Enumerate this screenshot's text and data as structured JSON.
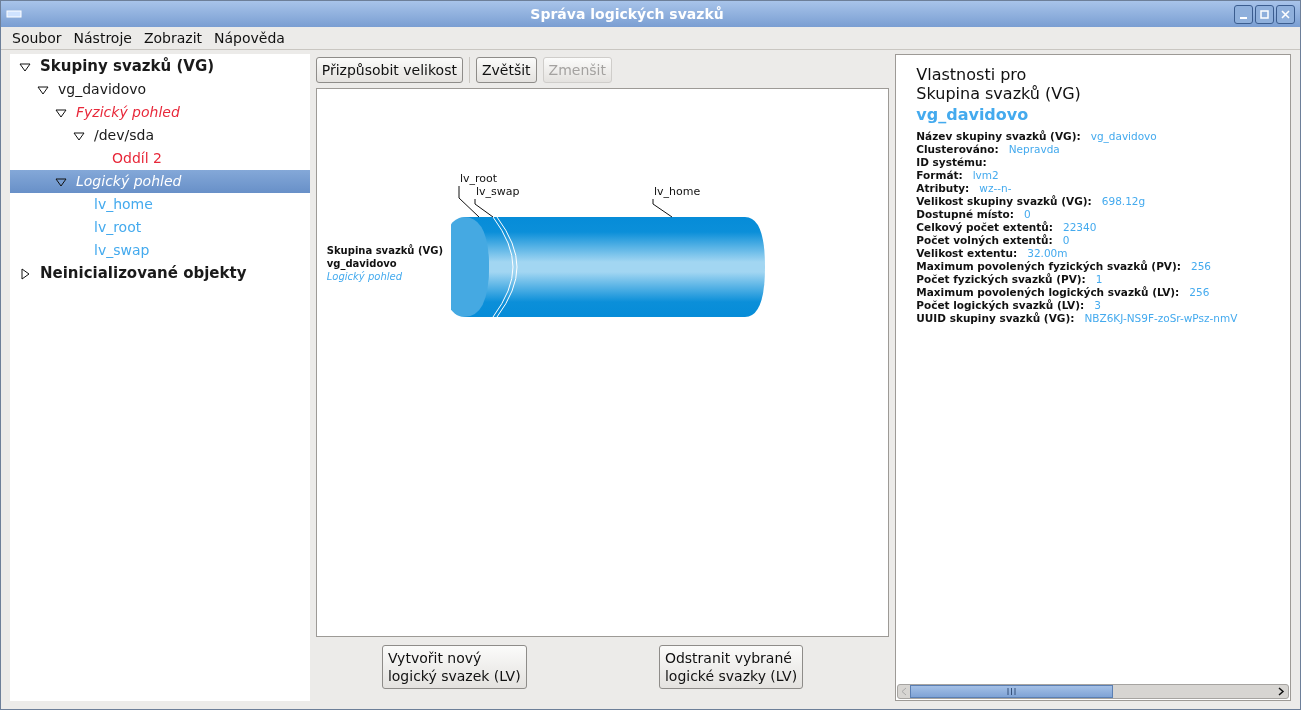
{
  "window": {
    "title": "Správa logických svazků"
  },
  "menu": [
    "Soubor",
    "Nástroje",
    "Zobrazit",
    "Nápověda"
  ],
  "tree": [
    {
      "label": "Skupiny svazků (VG)",
      "kind": "group",
      "expanded": true,
      "selected": false,
      "children": [
        {
          "label": "vg_davidovo",
          "kind": "vg",
          "expanded": true,
          "selected": false,
          "children": [
            {
              "label": "Fyzický pohled",
              "kind": "physical",
              "expanded": true,
              "selected": false,
              "children": [
                {
                  "label": "/dev/sda",
                  "kind": "pv",
                  "expanded": true,
                  "selected": false,
                  "children": [
                    {
                      "label": "Oddíl 2",
                      "kind": "partition",
                      "selected": false
                    }
                  ]
                }
              ]
            },
            {
              "label": "Logický pohled",
              "kind": "logical",
              "expanded": true,
              "selected": true,
              "children": [
                {
                  "label": "lv_home",
                  "kind": "lv",
                  "selected": false
                },
                {
                  "label": "lv_root",
                  "kind": "lv",
                  "selected": false
                },
                {
                  "label": "lv_swap",
                  "kind": "lv",
                  "selected": false
                }
              ]
            }
          ]
        }
      ]
    },
    {
      "label": "Neinicializované objekty",
      "kind": "group",
      "expanded": false,
      "selected": false
    }
  ],
  "toolbar": [
    {
      "label": "Přizpůsobit velikost",
      "disabled": false
    },
    {
      "label": "Zvětšit",
      "disabled": false
    },
    {
      "label": "Zmenšit",
      "disabled": true
    }
  ],
  "diagram": {
    "caption": [
      "Skupina svazků (VG)",
      "vg_davidovo"
    ],
    "view": "Logický pohled",
    "volumes": [
      "lv_root",
      "lv_swap",
      "lv_home"
    ]
  },
  "actions": [
    [
      "Vytvořit nový",
      "logický svazek (LV)"
    ],
    [
      "Odstranit vybrané",
      "logické svazky (LV)"
    ]
  ],
  "properties": {
    "heading": [
      "Vlastnosti pro",
      "Skupina svazků (VG)"
    ],
    "name": "vg_davidovo",
    "rows": [
      {
        "label": "Název skupiny svazků (VG):",
        "value": "vg_davidovo"
      },
      {
        "label": "Clusterováno:",
        "value": "Nepravda"
      },
      {
        "label": "ID systému:",
        "value": ""
      },
      {
        "label": "Formát:",
        "value": "lvm2"
      },
      {
        "label": "Atributy:",
        "value": "wz--n-"
      },
      {
        "label": "Velikost skupiny svazků (VG):",
        "value": "698.12g"
      },
      {
        "label": "Dostupné místo:",
        "value": "0"
      },
      {
        "label": "Celkový počet extentů:",
        "value": "22340"
      },
      {
        "label": "Počet volných extentů:",
        "value": "0"
      },
      {
        "label": "Velikost extentu:",
        "value": "32.00m"
      },
      {
        "label": "Maximum povolených fyzických svazků (PV):",
        "value": "256"
      },
      {
        "label": "Počet fyzických svazků (PV):",
        "value": "1"
      },
      {
        "label": "Maximum povolených logických svazků (LV):",
        "value": "256"
      },
      {
        "label": "Počet logických svazků (LV):",
        "value": "3"
      },
      {
        "label": "UUID skupiny svazků (VG):",
        "value": "NBZ6KJ-NS9F-zoSr-wPsz-nmV"
      }
    ]
  }
}
